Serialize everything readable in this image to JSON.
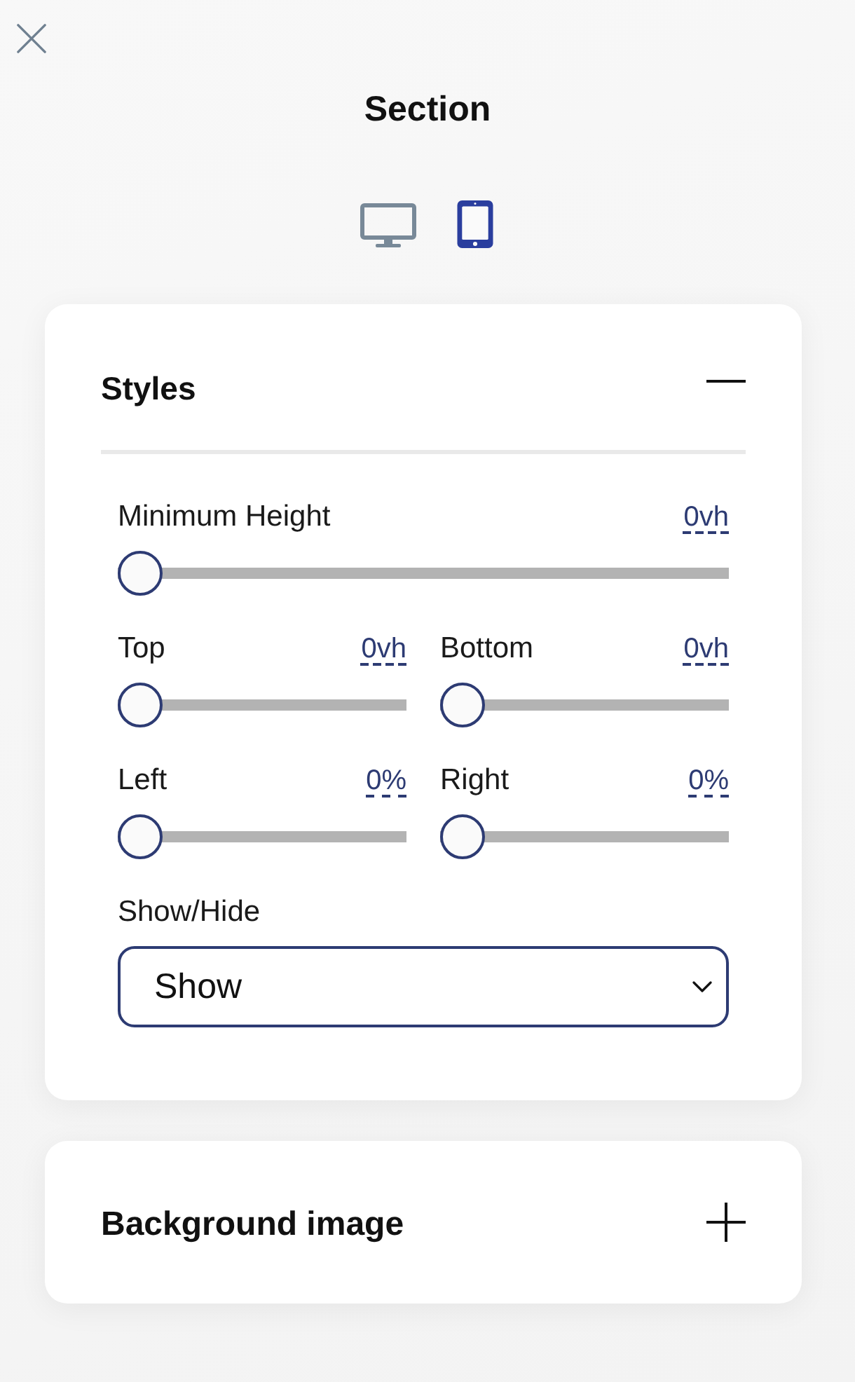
{
  "panel": {
    "title": "Section"
  },
  "devices": [
    {
      "kind": "desktop",
      "selected": false
    },
    {
      "kind": "tablet",
      "selected": true
    }
  ],
  "sections": [
    {
      "title": "Styles",
      "expanded": true,
      "slider_rows": [
        [
          {
            "label": "Minimum Height",
            "reading": "0vh",
            "level": 0
          }
        ],
        [
          {
            "label": "Top",
            "reading": "0vh",
            "level": 0
          },
          {
            "label": "Bottom",
            "reading": "0vh",
            "level": 0
          }
        ],
        [
          {
            "label": "Left",
            "reading": "0%",
            "level": 0
          },
          {
            "label": "Right",
            "reading": "0%",
            "level": 0
          }
        ]
      ],
      "select": {
        "label": "Show/Hide",
        "value": "Show"
      }
    },
    {
      "title": "Background image",
      "expanded": false
    }
  ]
}
